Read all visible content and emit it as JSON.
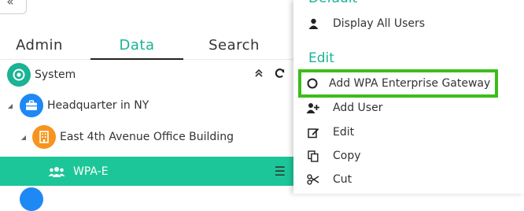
{
  "left_panel": {
    "tabs": [
      {
        "label": "Admin"
      },
      {
        "label": "Data"
      },
      {
        "label": "Search"
      }
    ],
    "active_tab": "Data",
    "tree": [
      {
        "label": "System",
        "icon": "target-icon",
        "color": "#1ab394"
      },
      {
        "label": "Headquarter in NY",
        "icon": "briefcase-icon",
        "color": "#1e88f5"
      },
      {
        "label": "East 4th Avenue Office Building",
        "icon": "building-icon",
        "color": "#f7941d"
      },
      {
        "label": "WPA-E",
        "icon": "group-icon",
        "color": "#1cc698"
      }
    ]
  },
  "right_panel": {
    "default_title": "Default",
    "display_all_users": "Display All Users",
    "edit_title": "Edit",
    "menu": [
      {
        "label": "Add WPA Enterprise Gateway",
        "icon": "circle-outline-icon"
      },
      {
        "label": "Add User",
        "icon": "user-plus-icon"
      },
      {
        "label": "Edit",
        "icon": "edit-icon"
      },
      {
        "label": "Copy",
        "icon": "copy-icon"
      },
      {
        "label": "Cut",
        "icon": "scissors-icon"
      }
    ]
  },
  "colors": {
    "accent": "#1ab394",
    "selected_row": "#1cc698",
    "highlight_border": "#3dbd1a"
  }
}
